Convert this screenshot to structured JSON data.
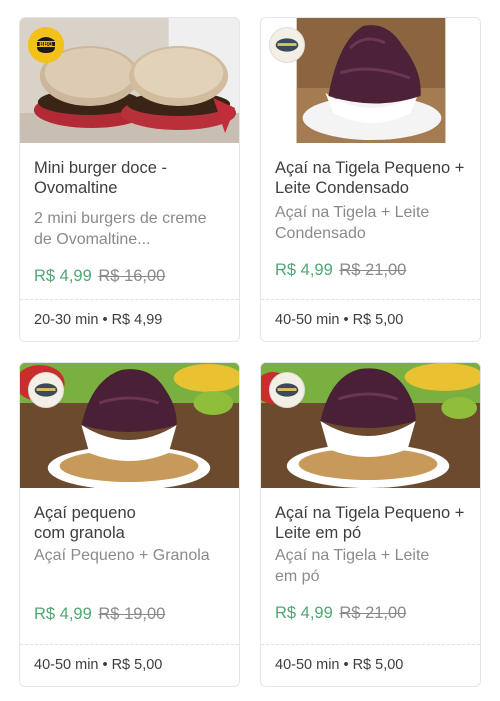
{
  "cards": [
    {
      "title": "Mini burger doce - Ovomaltine",
      "description": "2 mini burgers de creme de Ovomaltine...",
      "price": "R$ 4,99",
      "old_price": "R$ 16,00",
      "time": "20-30 min",
      "fee": "R$ 4,99",
      "logo_text": "BBG To Go"
    },
    {
      "title": "Açaí na Tigela Pequeno + Leite Condensado",
      "description": "Açaí na Tigela + Leite Condensado",
      "price": "R$ 4,99",
      "old_price": "R$ 21,00",
      "time": "40-50 min",
      "fee": "R$ 5,00"
    },
    {
      "title": "Açaí pequeno com granola",
      "description": "Açaí Pequeno + Granola",
      "price": "R$ 4,99",
      "old_price": "R$ 19,00",
      "time": "40-50 min",
      "fee": "R$ 5,00"
    },
    {
      "title": "Açaí na Tigela Pequeno + Leite em pó",
      "description": "Açaí na Tigela + Leite em pó",
      "price": "R$ 4,99",
      "old_price": "R$ 21,00",
      "time": "40-50 min",
      "fee": "R$ 5,00"
    }
  ],
  "separator": "•",
  "colors": {
    "price": "#50a773",
    "muted": "#8a8a8a",
    "text": "#3e3e3e",
    "border": "#e6e6e6"
  }
}
